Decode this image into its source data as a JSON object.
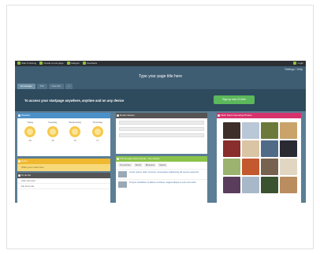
{
  "topbar": {
    "links": [
      "Start browsing",
      "Create a new page",
      "Gadgets",
      "Feedback"
    ],
    "login": "Login"
  },
  "header": {
    "settings": "Settings / Help",
    "title": "Type your page title here",
    "tabs": [
      "Homepage",
      "Tab",
      "New tab",
      "+"
    ]
  },
  "banner": {
    "message": "To access your startpage anywhere, anytime and on any device",
    "signup_label": "Sign up now. It's free"
  },
  "weather": {
    "title": "Weather",
    "days": [
      {
        "name": "Today",
        "temp": "20"
      },
      {
        "name": "Tuesday",
        "temp": "18"
      },
      {
        "name": "Wednesday",
        "temp": "19"
      },
      {
        "name": "Thursday",
        "temp": "17"
      }
    ]
  },
  "notes": {
    "title": "Notes",
    "body": "Write your notes here"
  },
  "todo": {
    "title": "To do list",
    "items": [
      "Add new item",
      "My first todo"
    ]
  },
  "email": {
    "title": "Email checker"
  },
  "news": {
    "title": "The Google News Feeds - Top stories",
    "tabs": [
      "Top stories",
      "World",
      "Business",
      "Sports"
    ],
    "items": [
      "Lorem ipsum dolor sit amet, consectetur adipiscing elit sed do eiusmod",
      "Tempor incididunt ut labore et dolore magna aliqua ut enim ad minim"
    ]
  },
  "photos": {
    "title": "Flickr Most Interesting Photos",
    "tiles": [
      "#3e2f2a",
      "#b9c7d6",
      "#6b7a3a",
      "#c9a36a",
      "#8a2d2d",
      "#d9c4a4",
      "#4f6b88",
      "#2a2a33",
      "#9bb36f",
      "#c4582e",
      "#77624f",
      "#e0d6c2",
      "#5a3d5c",
      "#a7b9c9",
      "#3b5230",
      "#b98d5e"
    ]
  }
}
